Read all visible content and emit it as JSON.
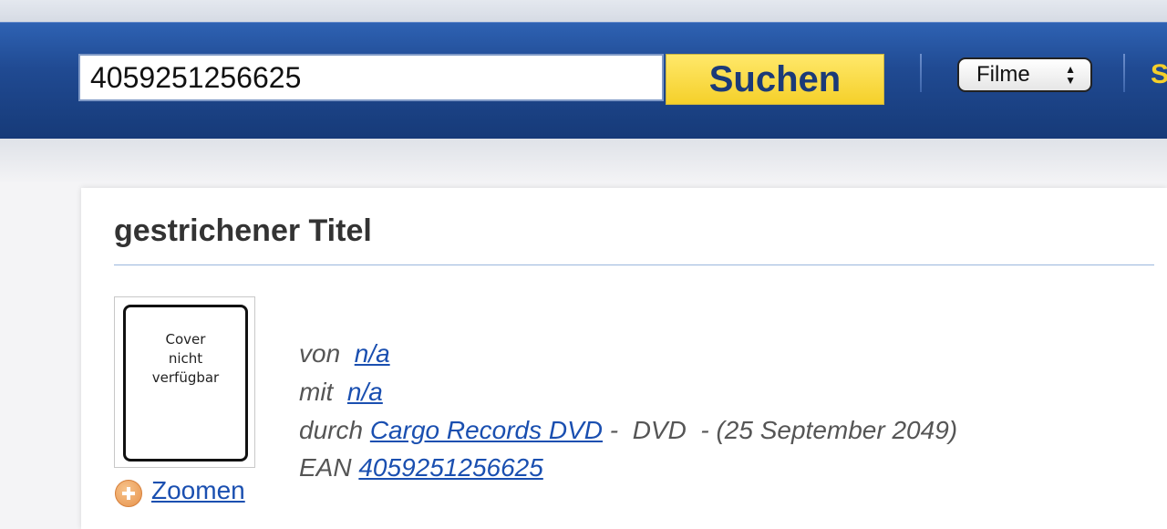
{
  "header": {
    "search_value": "4059251256625",
    "search_button_label": "Suchen",
    "category_select_value": "Filme",
    "nav_partial_label": "S"
  },
  "product": {
    "title": "gestrichener Titel",
    "cover_placeholder_line1": "Cover",
    "cover_placeholder_line2": "nicht",
    "cover_placeholder_line3": "verfügbar",
    "zoom_label": "Zoomen",
    "by_label": "von",
    "by_value": "n/a",
    "with_label": "mit",
    "with_value": "n/a",
    "through_label": "durch",
    "publisher": "Cargo Records DVD",
    "format_sep": " -  DVD  - ",
    "release_date": "(25 September 2049)",
    "ean_label": "EAN",
    "ean_value": "4059251256625"
  },
  "colors": {
    "header_blue": "#204a92",
    "search_button_yellow": "#f5d02a",
    "link_blue": "#1a4fb0"
  },
  "icons": {
    "zoom": "plus-circle-icon",
    "select_arrows": "updown-arrows-icon"
  }
}
